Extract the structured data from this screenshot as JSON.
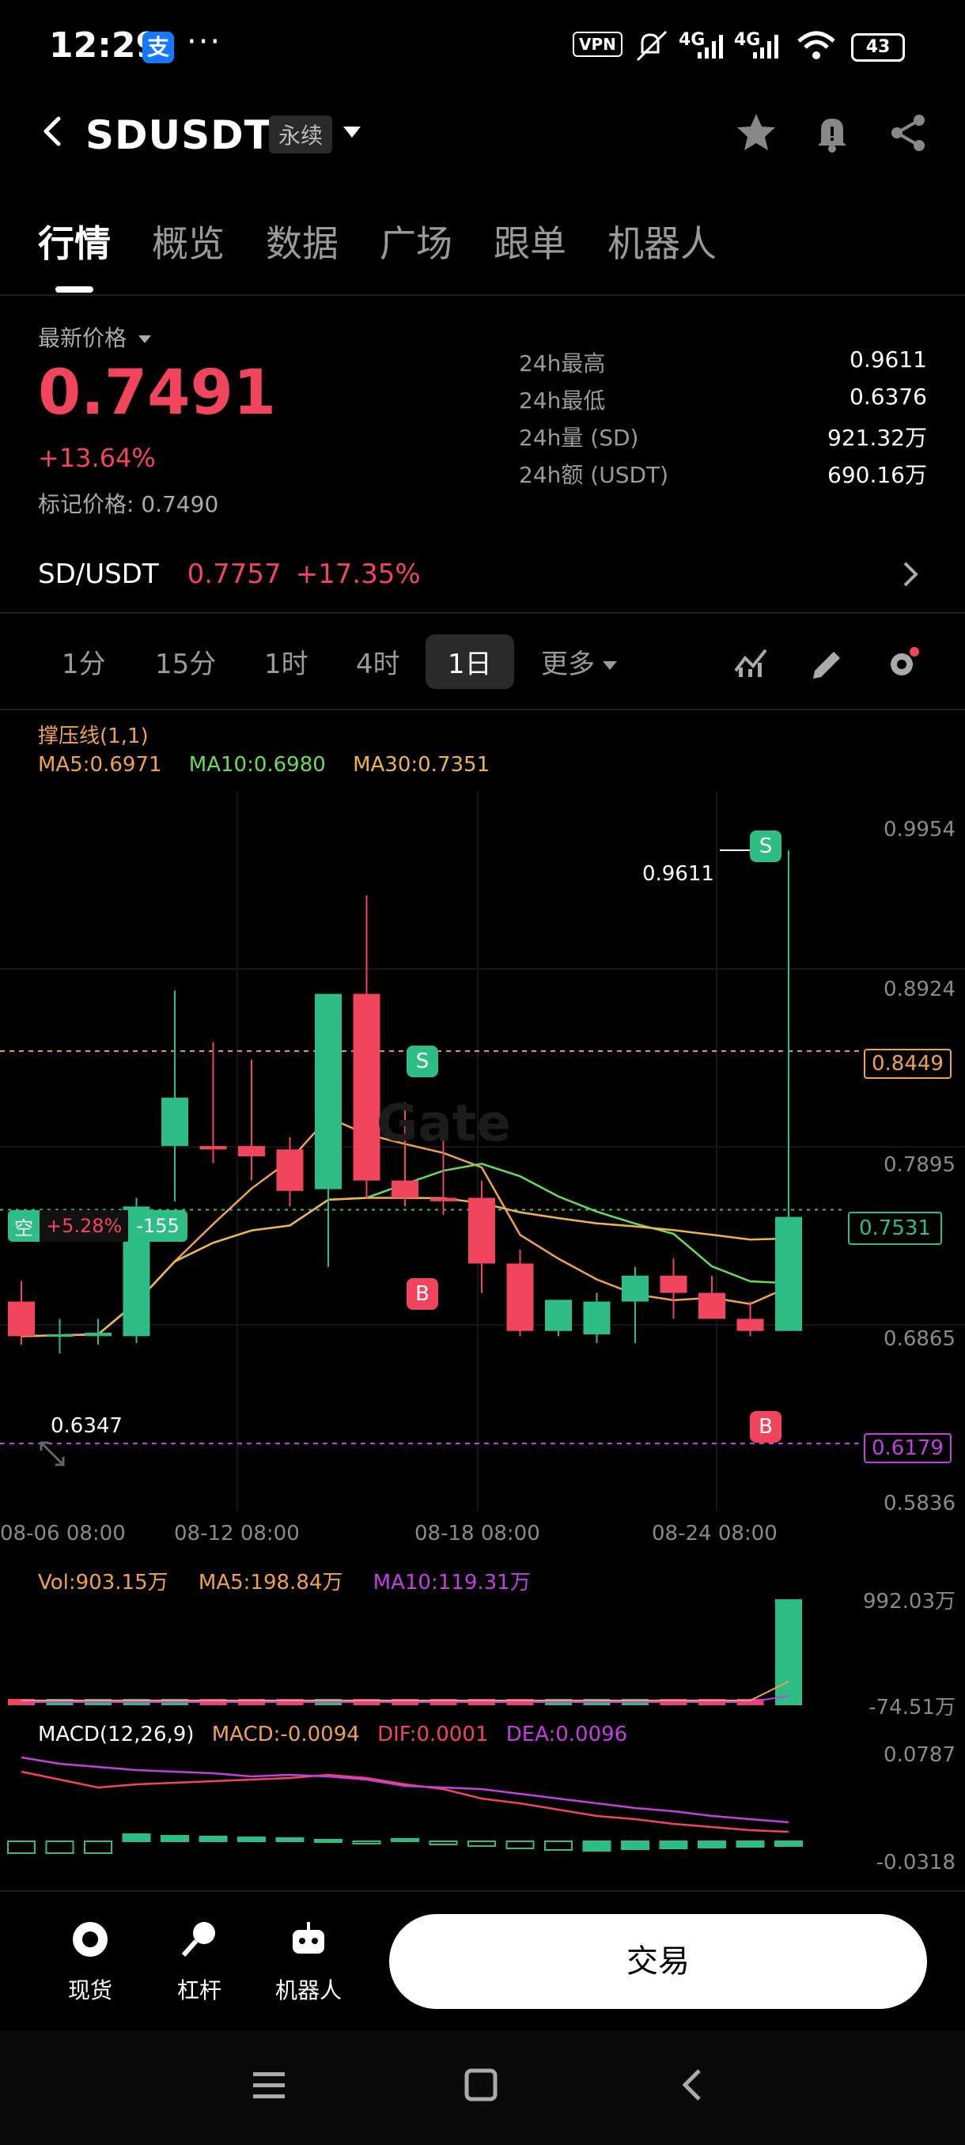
{
  "status_bar": {
    "time": "12:29",
    "alipay": "支",
    "dots": "···",
    "vpn": "VPN",
    "net1": "4G",
    "net2": "4G",
    "battery": "43"
  },
  "header": {
    "symbol": "SDUSDT",
    "badge": "永续"
  },
  "tabs": [
    "行情",
    "概览",
    "数据",
    "广场",
    "跟单",
    "机器人"
  ],
  "price_panel": {
    "latest_label": "最新价格",
    "last_price": "0.7491",
    "change_pct": "+13.64%",
    "mark_price_label": "标记价格: 0.7490",
    "stats": [
      {
        "label": "24h最高",
        "value": "0.9611"
      },
      {
        "label": "24h最低",
        "value": "0.6376"
      },
      {
        "label": "24h量 (SD)",
        "value": "921.32万"
      },
      {
        "label": "24h额 (USDT)",
        "value": "690.16万"
      }
    ],
    "spot_pair": {
      "name": "SD/USDT",
      "price": "0.7757",
      "change": "+17.35%"
    }
  },
  "intervals": {
    "items": [
      "1分",
      "15分",
      "1时",
      "4时",
      "1日",
      "更多"
    ],
    "active": "1日"
  },
  "chart": {
    "indicator": "撑压线(1,1)",
    "ma5": "MA5:0.6971",
    "ma10": "MA10:0.6980",
    "ma30": "MA30:0.7351",
    "y_ticks": [
      "0.9954",
      "0.8924",
      "0.7895",
      "0.6865",
      "0.5836"
    ],
    "x_ticks": [
      "08-06 08:00",
      "08-12 08:00",
      "08-18 08:00",
      "08-24 08:00"
    ],
    "high_marker": "0.9611",
    "low_marker": "0.6347",
    "resistance": "0.8449",
    "support": "0.6179",
    "current": "0.7531",
    "position": {
      "side": "空",
      "pnl": "+5.28%",
      "qty": "-155"
    },
    "signals": {
      "s": "S",
      "b": "B"
    },
    "watermark": "Gate"
  },
  "chart_data": {
    "type": "candlestick",
    "x_ticks": [
      "08-06 08:00",
      "08-12 08:00",
      "08-18 08:00",
      "08-24 08:00"
    ],
    "ylim": [
      0.5836,
      0.9954
    ],
    "candles": [
      {
        "o": 0.7,
        "h": 0.712,
        "l": 0.675,
        "c": 0.68
      },
      {
        "o": 0.68,
        "h": 0.69,
        "l": 0.67,
        "c": 0.681
      },
      {
        "o": 0.68,
        "h": 0.69,
        "l": 0.675,
        "c": 0.682
      },
      {
        "o": 0.68,
        "h": 0.76,
        "l": 0.676,
        "c": 0.755
      },
      {
        "o": 0.79,
        "h": 0.88,
        "l": 0.758,
        "c": 0.818
      },
      {
        "o": 0.79,
        "h": 0.85,
        "l": 0.78,
        "c": 0.788
      },
      {
        "o": 0.79,
        "h": 0.84,
        "l": 0.77,
        "c": 0.784
      },
      {
        "o": 0.788,
        "h": 0.795,
        "l": 0.755,
        "c": 0.764
      },
      {
        "o": 0.765,
        "h": 0.878,
        "l": 0.72,
        "c": 0.878
      },
      {
        "o": 0.878,
        "h": 0.935,
        "l": 0.76,
        "c": 0.77
      },
      {
        "o": 0.77,
        "h": 0.815,
        "l": 0.755,
        "c": 0.76
      },
      {
        "o": 0.76,
        "h": 0.795,
        "l": 0.75,
        "c": 0.758
      },
      {
        "o": 0.76,
        "h": 0.77,
        "l": 0.705,
        "c": 0.722
      },
      {
        "o": 0.722,
        "h": 0.73,
        "l": 0.68,
        "c": 0.683
      },
      {
        "o": 0.683,
        "h": 0.7,
        "l": 0.68,
        "c": 0.701
      },
      {
        "o": 0.681,
        "h": 0.705,
        "l": 0.676,
        "c": 0.7
      },
      {
        "o": 0.7,
        "h": 0.72,
        "l": 0.676,
        "c": 0.715
      },
      {
        "o": 0.715,
        "h": 0.725,
        "l": 0.69,
        "c": 0.705
      },
      {
        "o": 0.705,
        "h": 0.715,
        "l": 0.69,
        "c": 0.69
      },
      {
        "o": 0.69,
        "h": 0.7,
        "l": 0.68,
        "c": 0.683
      },
      {
        "o": 0.683,
        "h": 0.961,
        "l": 0.685,
        "c": 0.749
      }
    ],
    "ma5_label": "MA5:0.6971",
    "ma10_label": "MA10:0.6980",
    "ma30_label": "MA30:0.7351"
  },
  "volume": {
    "vol": "Vol:903.15万",
    "ma5": "MA5:198.84万",
    "ma10": "MA10:119.31万",
    "top": "992.03万",
    "bottom": "-74.51万"
  },
  "macd": {
    "label": "MACD(12,26,9)",
    "macd": "MACD:-0.0094",
    "dif": "DIF:0.0001",
    "dea": "DEA:0.0096",
    "top": "0.0787",
    "bottom": "-0.0318"
  },
  "bottom_bar": {
    "spot": "现货",
    "leverage": "杠杆",
    "robot": "机器人",
    "trade": "交易"
  },
  "colors": {
    "up": "#2ebd85",
    "down": "#f0455d",
    "bg": "#000000"
  }
}
